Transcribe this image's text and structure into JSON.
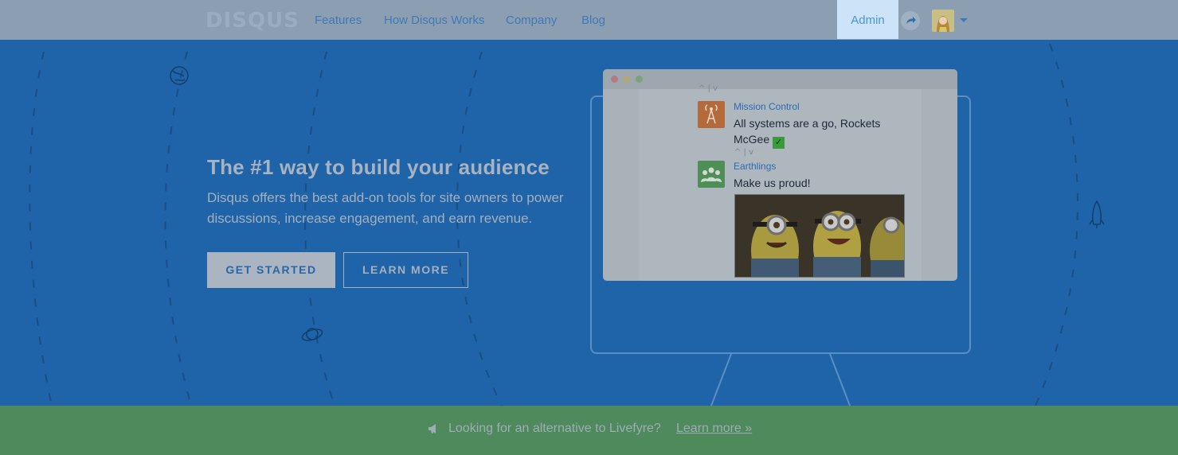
{
  "nav": {
    "logo": "DISQUS",
    "links": [
      "Features",
      "How Disqus Works",
      "Company",
      "Blog"
    ],
    "admin": "Admin"
  },
  "hero": {
    "title": "The #1 way to build your audience",
    "description": "Disqus offers the best add-on tools for site owners to power discussions, increase engagement, and earn revenue.",
    "get_started": "GET STARTED",
    "learn_more": "LEARN MORE"
  },
  "preview": {
    "comments": [
      {
        "author": "Mission Control",
        "text": "All systems are a go, Rockets McGee",
        "icon": "antenna-icon"
      },
      {
        "author": "Earthlings",
        "text": "Make us proud!",
        "icon": "group-icon"
      }
    ]
  },
  "banner": {
    "text": "Looking for an alternative to Livefyre?",
    "link": "Learn more »"
  },
  "colors": {
    "hero_bg": "#1f63a8",
    "nav_bg": "#8c9fb2",
    "banner_bg": "#4f8a5c",
    "admin_bg": "#cce3f8"
  }
}
